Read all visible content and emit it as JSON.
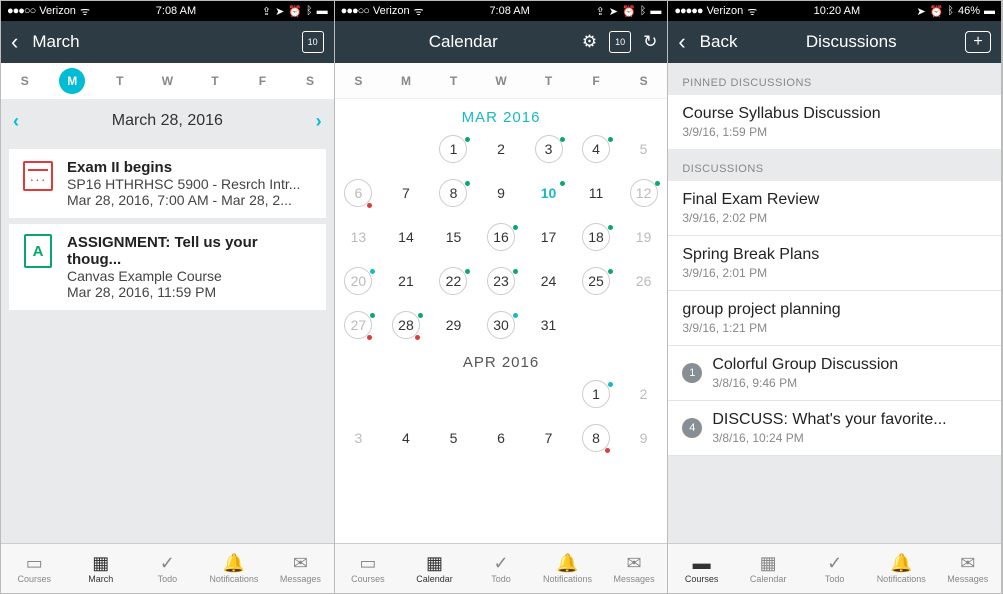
{
  "screen1": {
    "status": {
      "carrier": "Verizon",
      "time": "7:08 AM",
      "signal": "●●●○○",
      "wifi": "✓"
    },
    "nav": {
      "back": "March",
      "icon": "10"
    },
    "weekdays": [
      "S",
      "M",
      "T",
      "W",
      "T",
      "F",
      "S"
    ],
    "activeDayIndex": 1,
    "dateLabel": "March 28, 2016",
    "items": [
      {
        "title": "Exam II  begins",
        "sub": "SP16 HTHRHSC 5900 - Resrch Intr...",
        "time": "Mar 28, 2016, 7:00 AM - Mar 28, 2..."
      },
      {
        "title": "ASSIGNMENT: Tell us your thoug...",
        "sub": "Canvas Example Course",
        "time": "Mar 28, 2016, 11:59 PM"
      }
    ],
    "tabs": [
      "Courses",
      "March",
      "Todo",
      "Notifications",
      "Messages"
    ],
    "activeTab": 1
  },
  "screen2": {
    "status": {
      "carrier": "Verizon",
      "time": "7:08 AM",
      "signal": "●●●○○"
    },
    "nav": {
      "title": "Calendar",
      "icon": "10"
    },
    "weekdays": [
      "S",
      "M",
      "T",
      "W",
      "T",
      "F",
      "S"
    ],
    "monthLabel": "MAR 2016",
    "month2Label": "APR 2016",
    "tabs": [
      "Courses",
      "Calendar",
      "Todo",
      "Notifications",
      "Messages"
    ],
    "activeTab": 1
  },
  "screen3": {
    "status": {
      "carrier": "Verizon",
      "time": "10:20 AM",
      "signal": "●●●●●",
      "battery": "46%"
    },
    "nav": {
      "back": "Back",
      "title": "Discussions"
    },
    "pinnedHdr": "PINNED DISCUSSIONS",
    "discHdr": "DISCUSSIONS",
    "pinned": [
      {
        "title": "Course Syllabus Discussion",
        "ts": "3/9/16, 1:59 PM"
      }
    ],
    "discussions": [
      {
        "title": "Final Exam Review",
        "ts": "3/9/16, 2:02 PM"
      },
      {
        "title": "Spring Break Plans",
        "ts": "3/9/16, 2:01 PM"
      },
      {
        "title": "group project planning",
        "ts": "3/9/16, 1:21 PM"
      },
      {
        "title": "Colorful Group Discussion",
        "ts": "3/8/16, 9:46 PM",
        "badge": "1"
      },
      {
        "title": "DISCUSS: What's your favorite...",
        "ts": "3/8/16, 10:24 PM",
        "badge": "4"
      }
    ],
    "tabs": [
      "Courses",
      "Calendar",
      "Todo",
      "Notifications",
      "Messages"
    ],
    "activeTab": 0
  }
}
